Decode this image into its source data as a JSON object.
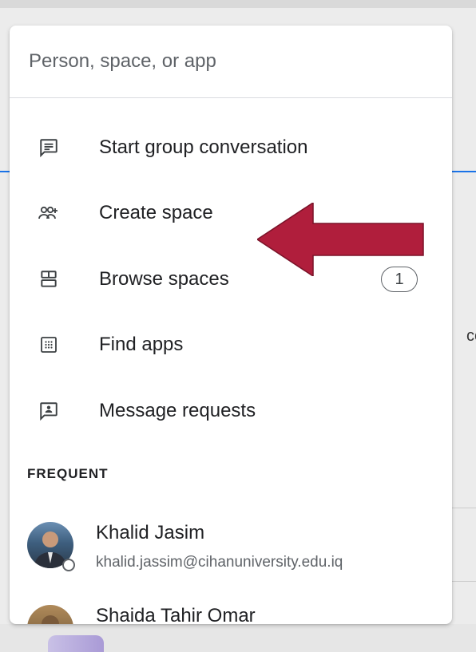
{
  "search": {
    "placeholder": "Person, space, or app"
  },
  "menu": {
    "items": [
      {
        "label": "Start group conversation",
        "icon": "chat-bubble-icon"
      },
      {
        "label": "Create space",
        "icon": "group-add-icon"
      },
      {
        "label": "Browse spaces",
        "icon": "browse-spaces-icon",
        "badge": "1"
      },
      {
        "label": "Find apps",
        "icon": "apps-grid-icon"
      },
      {
        "label": "Message requests",
        "icon": "message-request-icon"
      }
    ]
  },
  "frequent": {
    "title": "FREQUENT",
    "people": [
      {
        "name": "Khalid Jasim",
        "email": "khalid.jassim@cihanuniversity.edu.iq"
      },
      {
        "name": "Shaida Tahir Omar",
        "email": ""
      }
    ]
  },
  "background": {
    "partial_text": "cce"
  },
  "colors": {
    "arrow": "#b01e3c",
    "accent": "#1a73e8",
    "text": "#202124",
    "secondary": "#5f6368"
  }
}
